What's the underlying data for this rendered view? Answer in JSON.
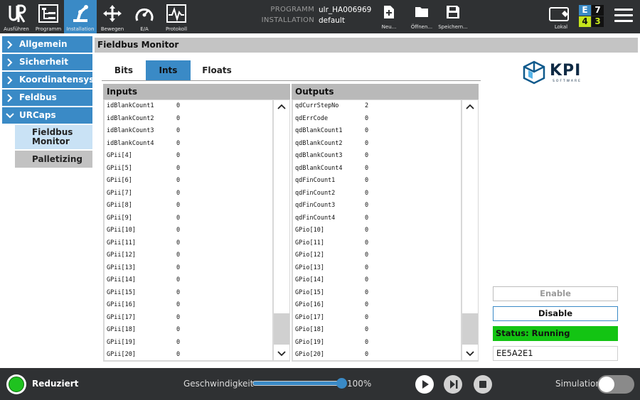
{
  "topbar": {
    "nav": [
      {
        "label": "Ausführen",
        "icon": "ur-logo-icon"
      },
      {
        "label": "Programm",
        "icon": "program-tree-icon"
      },
      {
        "label": "Installation",
        "icon": "robot-arm-icon"
      },
      {
        "label": "Bewegen",
        "icon": "move-arrows-icon"
      },
      {
        "label": "E/A",
        "icon": "io-gauge-icon"
      },
      {
        "label": "Protokoll",
        "icon": "log-chart-icon"
      }
    ],
    "program_key": "PROGRAMM",
    "program_value": "ulr_HA006969",
    "installation_key": "INSTALLATION",
    "installation_value": "default",
    "file_buttons": [
      {
        "label": "Neu...",
        "icon": "new-file-icon"
      },
      {
        "label": "Öffnen...",
        "icon": "open-folder-icon"
      },
      {
        "label": "Speichern...",
        "icon": "save-icon"
      }
    ],
    "local_label": "Lokal",
    "io_counts": [
      "E",
      "7",
      "4",
      "3"
    ]
  },
  "sidebar": {
    "items": [
      {
        "label": "Allgemein"
      },
      {
        "label": "Sicherheit"
      },
      {
        "label": "Koordinatensys"
      },
      {
        "label": "Feldbus"
      },
      {
        "label": "URCaps"
      }
    ],
    "subitems": [
      {
        "label": "Fieldbus Monitor",
        "selected": true
      },
      {
        "label": "Palletizing",
        "selected": false
      }
    ]
  },
  "main": {
    "title": "Fieldbus Monitor",
    "tabs": [
      "Bits",
      "Ints",
      "Floats"
    ],
    "active_tab": "Ints",
    "inputs": {
      "header": "Inputs",
      "rows": [
        {
          "name": "idBlankCount1",
          "value": "0"
        },
        {
          "name": "idBlankCount2",
          "value": "0"
        },
        {
          "name": "idBlankCount3",
          "value": "0"
        },
        {
          "name": "idBlankCount4",
          "value": "0"
        },
        {
          "name": "GPii[4]",
          "value": "0"
        },
        {
          "name": "GPii[5]",
          "value": "0"
        },
        {
          "name": "GPii[6]",
          "value": "0"
        },
        {
          "name": "GPii[7]",
          "value": "0"
        },
        {
          "name": "GPii[8]",
          "value": "0"
        },
        {
          "name": "GPii[9]",
          "value": "0"
        },
        {
          "name": "GPii[10]",
          "value": "0"
        },
        {
          "name": "GPii[11]",
          "value": "0"
        },
        {
          "name": "GPii[12]",
          "value": "0"
        },
        {
          "name": "GPii[13]",
          "value": "0"
        },
        {
          "name": "GPii[14]",
          "value": "0"
        },
        {
          "name": "GPii[15]",
          "value": "0"
        },
        {
          "name": "GPii[16]",
          "value": "0"
        },
        {
          "name": "GPii[17]",
          "value": "0"
        },
        {
          "name": "GPii[18]",
          "value": "0"
        },
        {
          "name": "GPii[19]",
          "value": "0"
        },
        {
          "name": "GPii[20]",
          "value": "0"
        }
      ]
    },
    "outputs": {
      "header": "Outputs",
      "rows": [
        {
          "name": "qdCurrStepNo",
          "value": "2"
        },
        {
          "name": "qdErrCode",
          "value": "0"
        },
        {
          "name": "qdBlankCount1",
          "value": "0"
        },
        {
          "name": "qdBlankCount2",
          "value": "0"
        },
        {
          "name": "qdBlankCount3",
          "value": "0"
        },
        {
          "name": "qdBlankCount4",
          "value": "0"
        },
        {
          "name": "qdFinCount1",
          "value": "0"
        },
        {
          "name": "qdFinCount2",
          "value": "0"
        },
        {
          "name": "qdFinCount3",
          "value": "0"
        },
        {
          "name": "qdFinCount4",
          "value": "0"
        },
        {
          "name": "GPio[10]",
          "value": "0"
        },
        {
          "name": "GPio[11]",
          "value": "0"
        },
        {
          "name": "GPio[12]",
          "value": "0"
        },
        {
          "name": "GPio[13]",
          "value": "0"
        },
        {
          "name": "GPio[14]",
          "value": "0"
        },
        {
          "name": "GPio[15]",
          "value": "0"
        },
        {
          "name": "GPio[16]",
          "value": "0"
        },
        {
          "name": "GPio[17]",
          "value": "0"
        },
        {
          "name": "GPio[18]",
          "value": "0"
        },
        {
          "name": "GPio[19]",
          "value": "0"
        },
        {
          "name": "GPio[20]",
          "value": "0"
        }
      ]
    },
    "logo": {
      "name": "KPI",
      "tagline": "SOFTWARE"
    },
    "enable_label": "Enable",
    "disable_label": "Disable",
    "status_text": "Status: Running",
    "serial": "EE5A2E1"
  },
  "bottombar": {
    "mode_label": "Reduziert",
    "speed_label": "Geschwindigkeit",
    "speed_value": "100%",
    "speed_level": 1.0,
    "simulation_label": "Simulation",
    "simulation_on": false
  },
  "colors": {
    "accent": "#3a8ac6",
    "topbar": "#2f3133",
    "status_running": "#13c413",
    "mode_indicator": "#1fc21f"
  }
}
